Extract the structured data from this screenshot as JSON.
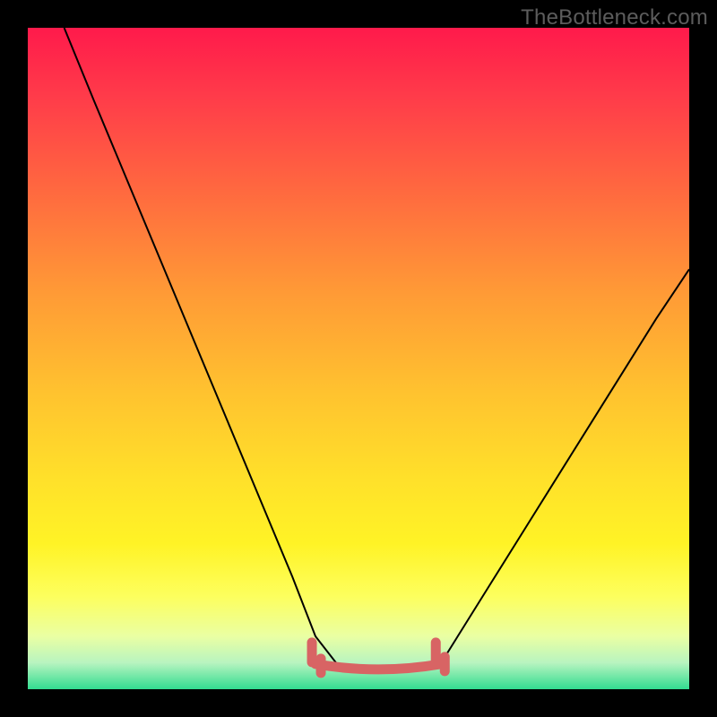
{
  "attribution": "TheBottleneck.com",
  "chart_data": {
    "type": "line",
    "title": "",
    "xlabel": "",
    "ylabel": "",
    "xlim": [
      0,
      100
    ],
    "ylim": [
      0,
      100
    ],
    "note": "Axes unlabeled; x/y are normalized 0–100 estimates read from pixel positions. y appears to represent bottleneck percentage (high=bad/red, low=good/green). Curve forms a V with minimum (~y=3) around x≈47–62. A salmon overlay highlights the flat optimal region near the bottom.",
    "series": [
      {
        "name": "bottleneck_curve",
        "x": [
          5.5,
          10,
          15,
          20,
          25,
          30,
          35,
          40,
          43.5,
          47,
          50,
          55,
          60,
          62.5,
          65,
          70,
          75,
          80,
          85,
          90,
          95,
          100
        ],
        "y": [
          100,
          89,
          77,
          65,
          53,
          41,
          29,
          17,
          8,
          3.5,
          2.8,
          2.6,
          2.9,
          4,
          8,
          16,
          24,
          32,
          40,
          48,
          56,
          63.5
        ]
      }
    ],
    "highlight_region": {
      "name": "optimal_flat_zone",
      "color": "#d86464",
      "x_range": [
        43.5,
        62.5
      ],
      "y_approx": 3
    },
    "background_gradient": {
      "direction": "vertical",
      "stops": [
        {
          "pos": 0.0,
          "color": "#ff1a4b"
        },
        {
          "pos": 0.5,
          "color": "#ffc22f"
        },
        {
          "pos": 0.85,
          "color": "#fdff5e"
        },
        {
          "pos": 1.0,
          "color": "#32dc90"
        }
      ]
    }
  }
}
